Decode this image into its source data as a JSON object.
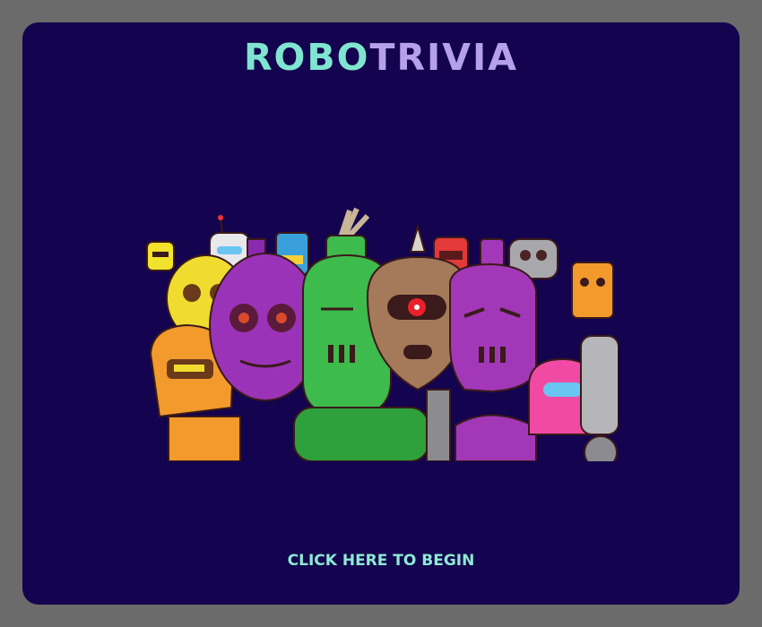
{
  "game": {
    "title_part1": "ROBO",
    "title_part2": "TRIVIA",
    "start_label": "CLICK HERE TO BEGIN"
  },
  "colors": {
    "background": "#6b6b6b",
    "panel": "#14034e",
    "title_part1": "#7fe5d0",
    "title_part2": "#b6a0ec",
    "start_label": "#8de9d4"
  },
  "artwork": {
    "subject": "crowd of cartoon robots",
    "icon": "robot-crowd-illustration"
  }
}
